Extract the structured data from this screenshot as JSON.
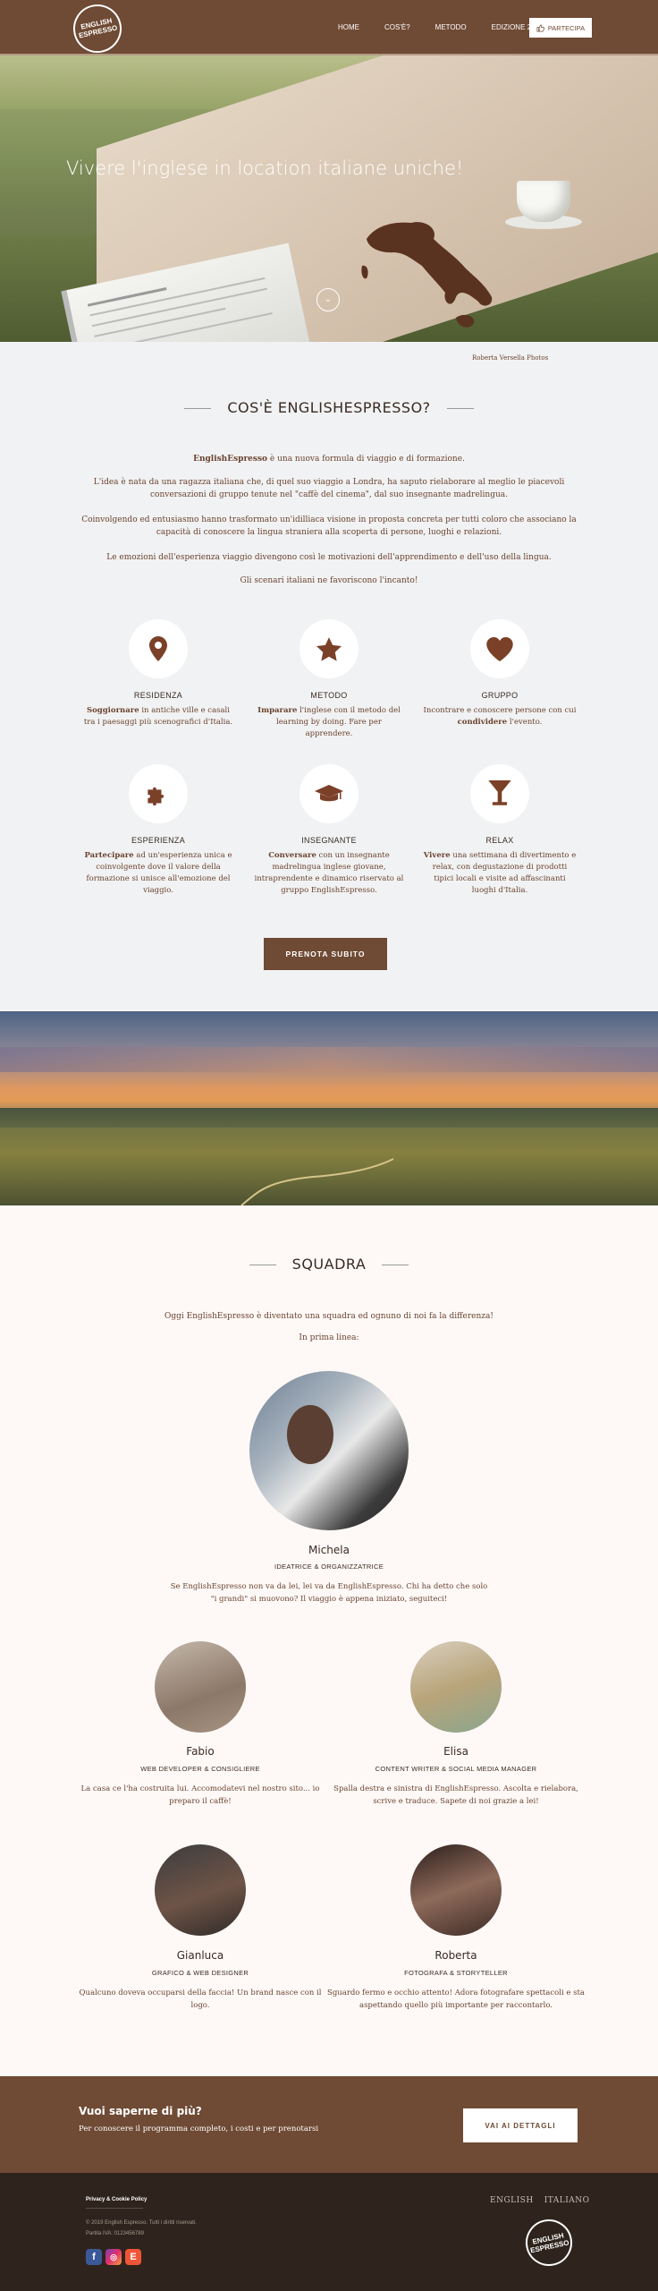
{
  "header": {
    "logo_line1": "ENGLISH",
    "logo_line2": "ESPRESSO",
    "nav": [
      "HOME",
      "COS'È?",
      "METODO",
      "EDIZIONE 2016"
    ],
    "join_label": "PARTECIPA",
    "brand_color": "#6f4a34"
  },
  "hero": {
    "title": "Vivere l'inglese in location italiane uniche!",
    "scroll_icon": "chevron-down-icon",
    "credit": "Roberta Versella Photos"
  },
  "about": {
    "title": "COS'È ENGLISHESPRESSO?",
    "p1_bold": "EnglishEspresso",
    "p1_rest": " è una nuova formula di viaggio e di formazione.",
    "p2": "L'idea è nata da una ragazza italiana che, di quel suo viaggio a Londra, ha saputo rielaborare al meglio le piacevoli conversazioni di gruppo tenute nel \"caffè del cinema\", dal suo insegnante madrelingua.",
    "p3": "Coinvolgendo ed entusiasmo hanno trasformato un'idilliaca visione in proposta concreta per tutti coloro che associano la capacità di conoscere la lingua straniera alla scoperta di persone, luoghi e relazioni.",
    "p4": "Le emozioni dell'esperienza viaggio divengono così le motivazioni dell'apprendimento e dell'uso della lingua.",
    "p5": "Gli scenari italiani ne favoriscono l'incanto!",
    "features": [
      {
        "icon": "map-pin-icon",
        "title": "RESIDENZA",
        "bold": "Soggiornare",
        "text": " in antiche ville e casali tra i paesaggi più scenografici d'Italia."
      },
      {
        "icon": "star-icon",
        "title": "METODO",
        "bold": "Imparare",
        "text": " l'inglese con il metodo del learning by doing. Fare per apprendere."
      },
      {
        "icon": "heart-icon",
        "title": "GRUPPO",
        "bold": "",
        "text": "Incontrare e conoscere persone con cui ",
        "bold2": "condividere",
        "text2": " l'evento."
      },
      {
        "icon": "puzzle-icon",
        "title": "ESPERIENZA",
        "bold": "Partecipare",
        "text": " ad un'esperienza unica e coinvolgente dove il valore della formazione si unisce all'emozione del viaggio."
      },
      {
        "icon": "graduation-cap-icon",
        "title": "INSEGNANTE",
        "bold": "Conversare",
        "text": " con un insegnante madrelingua inglese giovane, intraprendente e dinamico riservato al gruppo EnglishEspresso."
      },
      {
        "icon": "cocktail-icon",
        "title": "RELAX",
        "bold": "Vivere",
        "text": " una settimana di divertimento e relax, con degustazione di prodotti tipici locali e visite ad affascinanti luoghi d'Italia."
      }
    ],
    "book_label": "PRENOTA SUBITO"
  },
  "team": {
    "title": "SQUADRA",
    "intro1": "Oggi EnglishEspresso è diventato una squadra ed ognuno di noi fa la differenza!",
    "intro2": "In prima linea:",
    "lead": {
      "name": "Michela",
      "role": "IDEATRICE & ORGANIZZATRICE",
      "desc": "Se EnglishEspresso non va da lei, lei va da EnglishEspresso. Chi ha detto che solo \"i grandi\" si muovono? Il viaggio è appena iniziato, seguiteci!"
    },
    "members": [
      {
        "name": "Fabio",
        "role": "WEB DEVELOPER & CONSIGLIERE",
        "desc": "La casa ce l'ha costruita lui. Accomodatevi nel nostro sito... io preparo il caffè!"
      },
      {
        "name": "Elisa",
        "role": "CONTENT WRITER & SOCIAL MEDIA MANAGER",
        "desc": "Spalla destra e sinistra di EnglishEspresso. Ascolta e rielabora, scrive e traduce. Sapete di noi grazie a lei!"
      },
      {
        "name": "Gianluca",
        "role": "GRAFICO & WEB DESIGNER",
        "desc": "Qualcuno doveva occuparsi della faccia! Un brand nasce con il logo."
      },
      {
        "name": "Roberta",
        "role": "FOTOGRAFA & STORYTELLER",
        "desc": "Sguardo fermo e occhio attento! Adora fotografare spettacoli e sta aspettando quello più importante per raccontarlo."
      }
    ]
  },
  "cta": {
    "title": "Vuoi saperne di più?",
    "subtitle": "Per conoscere il programma completo, i costi e per prenotarsi",
    "button": "VAI AI DETTAGLI"
  },
  "footer": {
    "privacy": "Privacy & Cookie Policy",
    "copyright": "© 2019 English Espresso. Tutti i diritti riservati.",
    "vat": "Partita IVA: 0123456789",
    "social": [
      "facebook-icon",
      "instagram-icon",
      "eventbrite-icon"
    ],
    "languages": [
      "ENGLISH",
      "ITALIANO"
    ]
  }
}
